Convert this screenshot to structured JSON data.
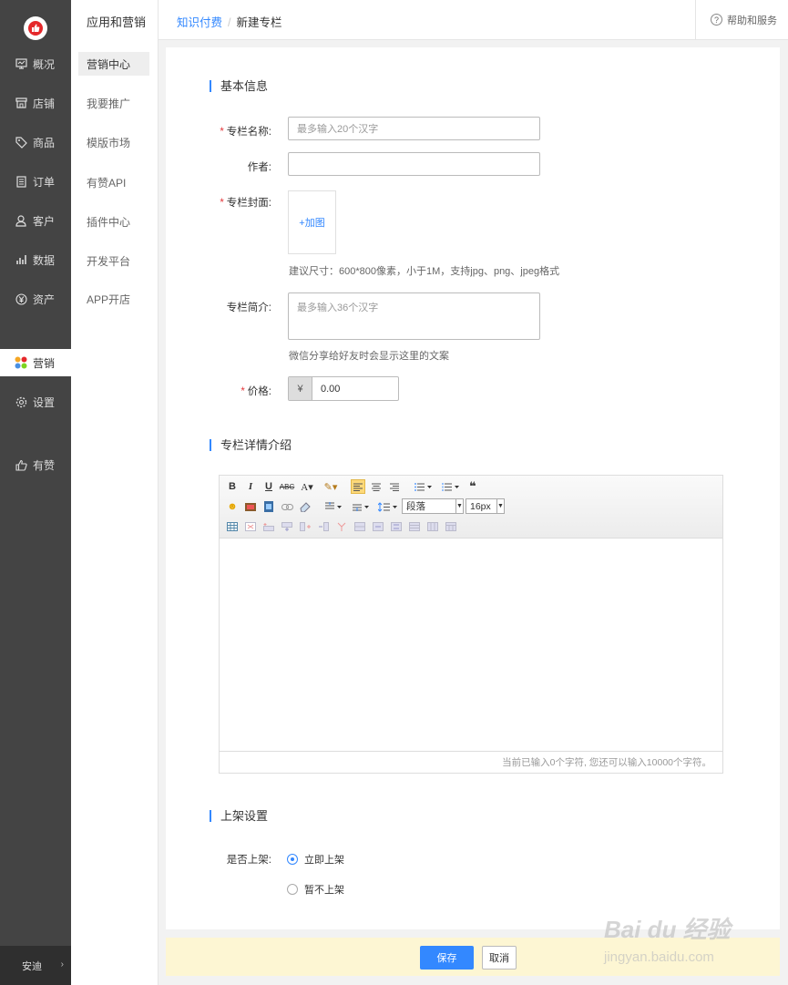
{
  "colors": {
    "accent": "#3388ff",
    "sidebar": "#444444",
    "required": "#e4393c",
    "action_bar": "#fdf6d3"
  },
  "nav_primary": {
    "items": [
      {
        "label": "概况",
        "icon": "monitor-icon"
      },
      {
        "label": "店铺",
        "icon": "shop-icon"
      },
      {
        "label": "商品",
        "icon": "tag-icon"
      },
      {
        "label": "订单",
        "icon": "document-icon"
      },
      {
        "label": "客户",
        "icon": "user-icon"
      },
      {
        "label": "数据",
        "icon": "bar-chart-icon"
      },
      {
        "label": "资产",
        "icon": "yen-icon"
      },
      {
        "label": "营销",
        "icon": "marketing-icon"
      },
      {
        "label": "设置",
        "icon": "gear-icon"
      },
      {
        "label": "有赞",
        "icon": "thumbs-up-icon"
      }
    ],
    "active": "营销",
    "store_label": "安迪",
    "store_arrow": "›"
  },
  "nav_secondary": {
    "title": "应用和营销",
    "items": [
      "营销中心",
      "我要推广",
      "模版市场",
      "有赞API",
      "插件中心",
      "开发平台",
      "APP开店"
    ],
    "active": "营销中心"
  },
  "header": {
    "breadcrumb_link": "知识付费",
    "breadcrumb_sep": "/",
    "breadcrumb_current": "新建专栏",
    "help_label": "帮助和服务",
    "help_icon_glyph": "?"
  },
  "basic": {
    "section_title": "基本信息",
    "name_label": "专栏名称:",
    "name_placeholder": "最多输入20个汉字",
    "author_label": "作者:",
    "author_value": "",
    "cover_label": "专栏封面:",
    "cover_add": "+加图",
    "cover_hint": "建议尺寸：600*800像素，小于1M，支持jpg、png、jpeg格式",
    "intro_label": "专栏简介:",
    "intro_placeholder": "最多输入36个汉字",
    "intro_hint": "微信分享给好友时会显示这里的文案",
    "price_label": "价格:",
    "price_currency": "¥",
    "price_value": "0.00",
    "required_mark": "*"
  },
  "detail": {
    "section_title": "专栏详情介绍",
    "editor": {
      "paragraph_select": "段落",
      "font_size_select": "16px",
      "counter_text": "当前已输入0个字符, 您还可以输入10000个字符。"
    }
  },
  "shelf": {
    "section_title": "上架设置",
    "label": "是否上架:",
    "options": [
      "立即上架",
      "暂不上架"
    ],
    "selected": "立即上架"
  },
  "actions": {
    "save": "保存",
    "cancel": "取消"
  },
  "watermark": {
    "line1": "Bai du 经验",
    "line2": "jingyan.baidu.com"
  }
}
